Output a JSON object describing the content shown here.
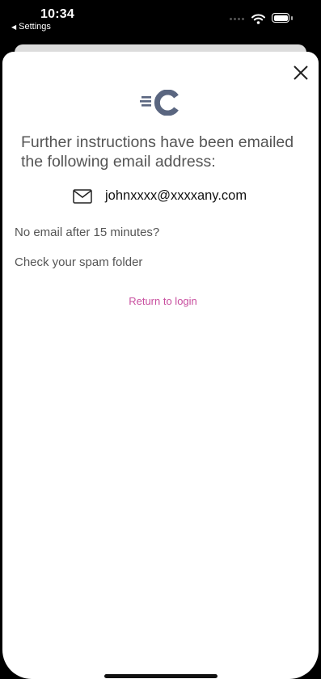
{
  "status_bar": {
    "time": "10:34",
    "back_label": "Settings"
  },
  "colors": {
    "accent_link": "#c84f9f",
    "logo": "#5a6680",
    "text_muted": "#555555"
  },
  "logo": {
    "icon": "brand-c-logo"
  },
  "message": {
    "headline": "Further instructions have been emailed the following email address:",
    "email_icon": "envelope-icon",
    "email": "johnxxxx@xxxxany.com",
    "no_email": "No email after 15 minutes?",
    "spam_hint": "Check your spam folder"
  },
  "actions": {
    "return_login": "Return to login",
    "close_icon": "close-icon"
  }
}
